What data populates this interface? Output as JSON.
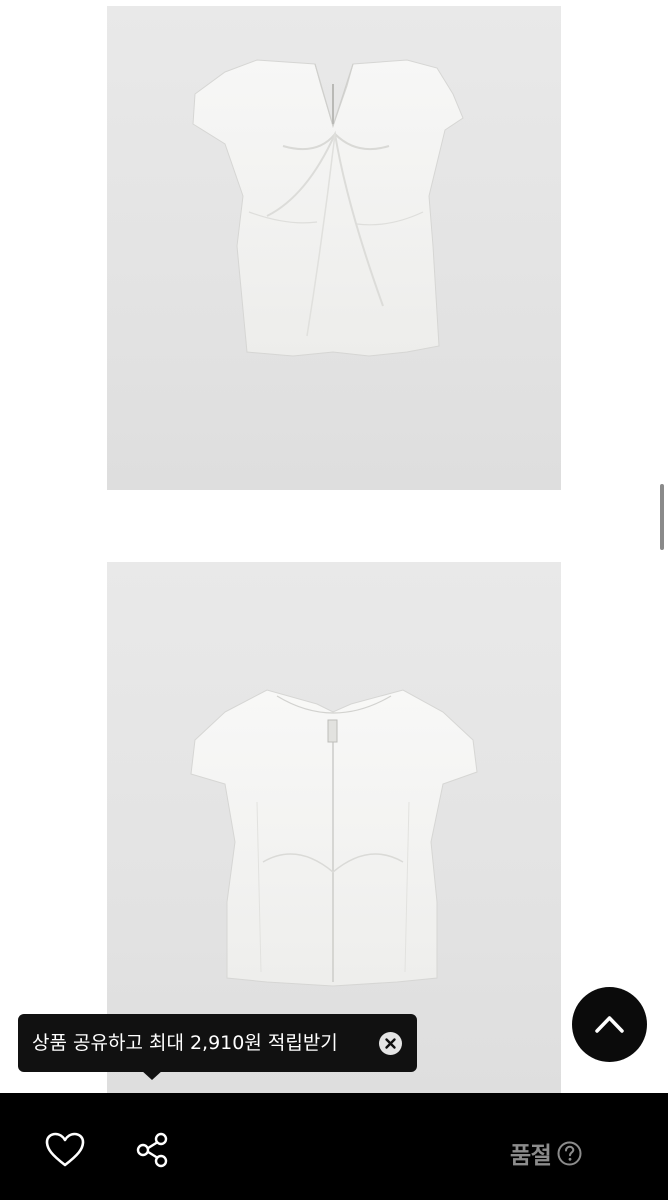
{
  "product": {
    "images": [
      {
        "name": "front",
        "alt": "front view"
      },
      {
        "name": "back",
        "alt": "back view"
      }
    ]
  },
  "tooltip": {
    "text": "상품 공유하고 최대 2,910원 적립받기",
    "close_icon": "close-icon"
  },
  "scroll_top": {
    "icon": "chevron-up-icon"
  },
  "bottom_bar": {
    "like_icon": "heart-icon",
    "share_icon": "share-icon",
    "status_label": "품절",
    "help_icon": "question-icon"
  },
  "colors": {
    "bottom_bar_bg": "#000000",
    "tooltip_bg": "#111111",
    "status_text": "#8c8c8c",
    "image_bg": "#e6e6e6"
  }
}
